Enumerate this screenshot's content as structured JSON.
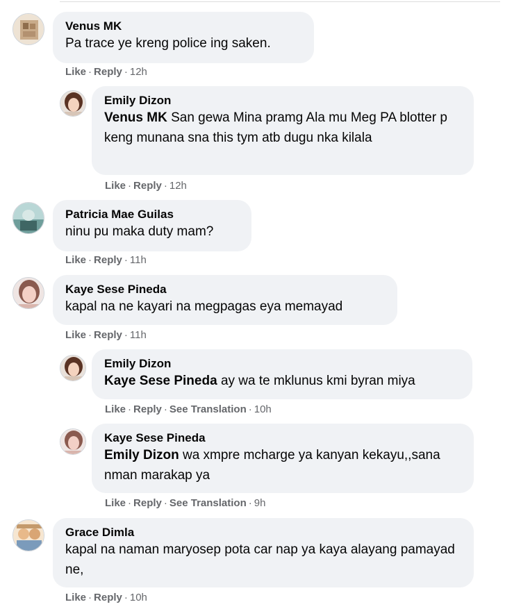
{
  "comments": [
    {
      "author": "Venus MK",
      "text": "Pa trace ye kreng police ing saken.",
      "actions": {
        "like": "Like",
        "reply": "Reply",
        "time": "12h"
      },
      "avatar_colors": [
        "#e9d9c6",
        "#b99c7e"
      ]
    },
    {
      "author": "Emily Dizon",
      "mention": "Venus MK",
      "text": "San gewa Mina pramg Ala mu Meg PA blotter p keng munana sna this tym atb dugu nka kilala",
      "actions": {
        "like": "Like",
        "reply": "Reply",
        "time": "12h"
      },
      "avatar_colors": [
        "#f3d9c9",
        "#6a3b28"
      ]
    },
    {
      "author": "Patricia Mae Guilas",
      "text": "ninu pu maka duty mam?",
      "actions": {
        "like": "Like",
        "reply": "Reply",
        "time": "11h"
      },
      "avatar_colors": [
        "#9fc3c4",
        "#4b7a79"
      ]
    },
    {
      "author": "Kaye Sese Pineda",
      "text": "kapal na ne kayari na megpagas eya memayad",
      "actions": {
        "like": "Like",
        "reply": "Reply",
        "time": "11h"
      },
      "avatar_colors": [
        "#e6b7b3",
        "#7c4b45"
      ]
    },
    {
      "author": "Emily Dizon",
      "mention": "Kaye Sese Pineda",
      "text": "ay wa te mklunus kmi byran miya",
      "actions": {
        "like": "Like",
        "reply": "Reply",
        "translate": "See Translation",
        "time": "10h"
      },
      "avatar_colors": [
        "#f3d9c9",
        "#6a3b28"
      ]
    },
    {
      "author": "Kaye Sese Pineda",
      "mention": "Emily Dizon",
      "text": "wa xmpre mcharge ya kanyan kekayu,,sana nman marakap ya",
      "actions": {
        "like": "Like",
        "reply": "Reply",
        "translate": "See Translation",
        "time": "9h"
      },
      "avatar_colors": [
        "#e6b7b3",
        "#7c4b45"
      ]
    },
    {
      "author": "Grace Dimla",
      "text": "kapal na naman maryosep pota car nap ya kaya alayang pamayad ne,",
      "actions": {
        "like": "Like",
        "reply": "Reply",
        "time": "10h"
      },
      "avatar_colors": [
        "#f0c9a0",
        "#7a9ab8"
      ]
    }
  ],
  "colors": {
    "bubble": "#f0f2f5",
    "action_text": "#65676b",
    "text": "#050505"
  }
}
